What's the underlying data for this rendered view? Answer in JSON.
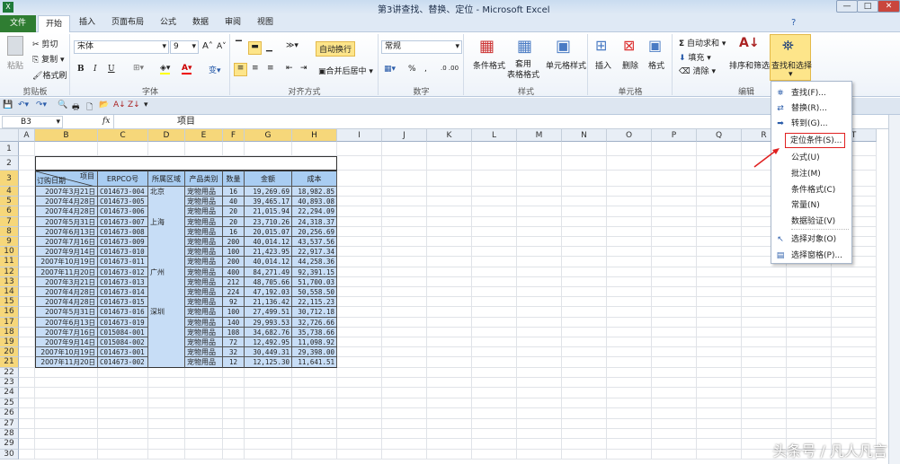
{
  "window": {
    "title": "第3讲查找、替换、定位 - Microsoft Excel",
    "controls": [
      "—",
      "□",
      "✕"
    ]
  },
  "tabs": {
    "file": "文件",
    "items": [
      "开始",
      "插入",
      "页面布局",
      "公式",
      "数据",
      "审阅",
      "视图"
    ],
    "active": "开始"
  },
  "ribbon": {
    "clipboard": {
      "label": "剪贴板",
      "paste": "粘贴",
      "cut": "剪切",
      "copy": "复制",
      "format_painter": "格式刷"
    },
    "font": {
      "label": "字体",
      "name": "宋体",
      "size": "9",
      "grow": "A˄",
      "shrink": "A˅",
      "bold": "B",
      "italic": "I",
      "underline": "U"
    },
    "alignment": {
      "label": "对齐方式",
      "wrap": "自动换行",
      "merge": "合并后居中"
    },
    "number": {
      "label": "数字",
      "format": "常规",
      "percent": "%",
      "comma": ","
    },
    "styles": {
      "label": "样式",
      "conditional": "条件格式",
      "table": "套用\n表格格式",
      "cell": "单元格样式"
    },
    "cells": {
      "label": "单元格",
      "insert": "插入",
      "delete": "删除",
      "format": "格式"
    },
    "editing": {
      "label": "编辑",
      "autosum": "自动求和",
      "fill": "填充",
      "clear": "清除",
      "sort": "排序和筛选",
      "find": "查找和选择"
    }
  },
  "formula_bar": {
    "name_box": "B3",
    "fx": "fx",
    "content": "项目"
  },
  "columns": [
    "A",
    "B",
    "C",
    "D",
    "E",
    "F",
    "G",
    "H",
    "I",
    "J",
    "K",
    "L",
    "M",
    "N",
    "O",
    "P",
    "Q",
    "R",
    "S",
    "T"
  ],
  "selected_columns": [
    "B",
    "C",
    "D",
    "E",
    "F",
    "G",
    "H"
  ],
  "rows": [
    "1",
    "2",
    "3",
    "4",
    "5",
    "6",
    "7",
    "8",
    "9",
    "10",
    "11",
    "12",
    "13",
    "14",
    "15",
    "16",
    "17",
    "18",
    "19",
    "20",
    "21",
    "22",
    "23",
    "24",
    "25",
    "26",
    "27",
    "28",
    "29",
    "30"
  ],
  "table": {
    "header_corner_top": "项目",
    "header_corner_bottom": "订购日期",
    "headers": [
      "ERPCO号",
      "所属区域",
      "产品类别",
      "数量",
      "金额",
      "成本"
    ],
    "rows": [
      [
        "2007年3月21日",
        "C014673-004",
        "北京",
        "宠物用品",
        "16",
        "19,269.69",
        "18,982.85"
      ],
      [
        "2007年4月28日",
        "C014673-005",
        "",
        "宠物用品",
        "40",
        "39,465.17",
        "40,893.08"
      ],
      [
        "2007年4月28日",
        "C014673-006",
        "",
        "宠物用品",
        "20",
        "21,015.94",
        "22,294.09"
      ],
      [
        "2007年5月31日",
        "C014673-007",
        "上海",
        "宠物用品",
        "20",
        "23,710.26",
        "24,318.37"
      ],
      [
        "2007年6月13日",
        "C014673-008",
        "",
        "宠物用品",
        "16",
        "20,015.07",
        "20,256.69"
      ],
      [
        "2007年7月16日",
        "C014673-009",
        "",
        "宠物用品",
        "200",
        "40,014.12",
        "43,537.56"
      ],
      [
        "2007年9月14日",
        "C014673-010",
        "",
        "宠物用品",
        "100",
        "21,423.95",
        "22,917.34"
      ],
      [
        "2007年10月19日",
        "C014673-011",
        "",
        "宠物用品",
        "200",
        "40,014.12",
        "44,258.36"
      ],
      [
        "2007年11月20日",
        "C014673-012",
        "广州",
        "宠物用品",
        "400",
        "84,271.49",
        "92,391.15"
      ],
      [
        "2007年3月21日",
        "C014673-013",
        "",
        "宠物用品",
        "212",
        "48,705.66",
        "51,700.03"
      ],
      [
        "2007年4月28日",
        "C014673-014",
        "",
        "宠物用品",
        "224",
        "47,192.03",
        "50,558.50"
      ],
      [
        "2007年4月28日",
        "C014673-015",
        "",
        "宠物用品",
        "92",
        "21,136.42",
        "22,115.23"
      ],
      [
        "2007年5月31日",
        "C014673-016",
        "深圳",
        "宠物用品",
        "100",
        "27,499.51",
        "30,712.18"
      ],
      [
        "2007年6月13日",
        "C014673-019",
        "",
        "宠物用品",
        "140",
        "29,993.53",
        "32,726.66"
      ],
      [
        "2007年7月16日",
        "C015084-001",
        "",
        "宠物用品",
        "108",
        "34,682.76",
        "35,738.66"
      ],
      [
        "2007年9月14日",
        "C015084-002",
        "",
        "宠物用品",
        "72",
        "12,492.95",
        "11,098.92"
      ],
      [
        "2007年10月19日",
        "C014673-001",
        "",
        "宠物用品",
        "32",
        "30,449.31",
        "29,398.00"
      ],
      [
        "2007年11月20日",
        "C014673-002",
        "",
        "宠物用品",
        "12",
        "12,125.30",
        "11,641.51"
      ]
    ]
  },
  "dropdown": {
    "items": [
      {
        "icon": "binoculars-icon",
        "label": "查找(F)..."
      },
      {
        "icon": "replace-icon",
        "label": "替换(R)..."
      },
      {
        "icon": "arrow-right-icon",
        "label": "转到(G)..."
      },
      {
        "icon": "",
        "label": "定位条件(S)...",
        "highlighted": true
      },
      {
        "icon": "",
        "label": "公式(U)"
      },
      {
        "icon": "",
        "label": "批注(M)"
      },
      {
        "icon": "",
        "label": "条件格式(C)"
      },
      {
        "icon": "",
        "label": "常量(N)"
      },
      {
        "icon": "",
        "label": "数据验证(V)"
      },
      {
        "icon": "cursor-icon",
        "label": "选择对象(O)"
      },
      {
        "icon": "selection-pane-icon",
        "label": "选择窗格(P)..."
      }
    ]
  },
  "colors": {
    "table_fill": "#c7ddf6",
    "header_fill": "#a9cdf2",
    "highlight_box": "#e02020",
    "file_tab": "#2f7d32",
    "selected_header": "#f6d77a"
  },
  "watermark": "头条号 / 凡人凡言"
}
